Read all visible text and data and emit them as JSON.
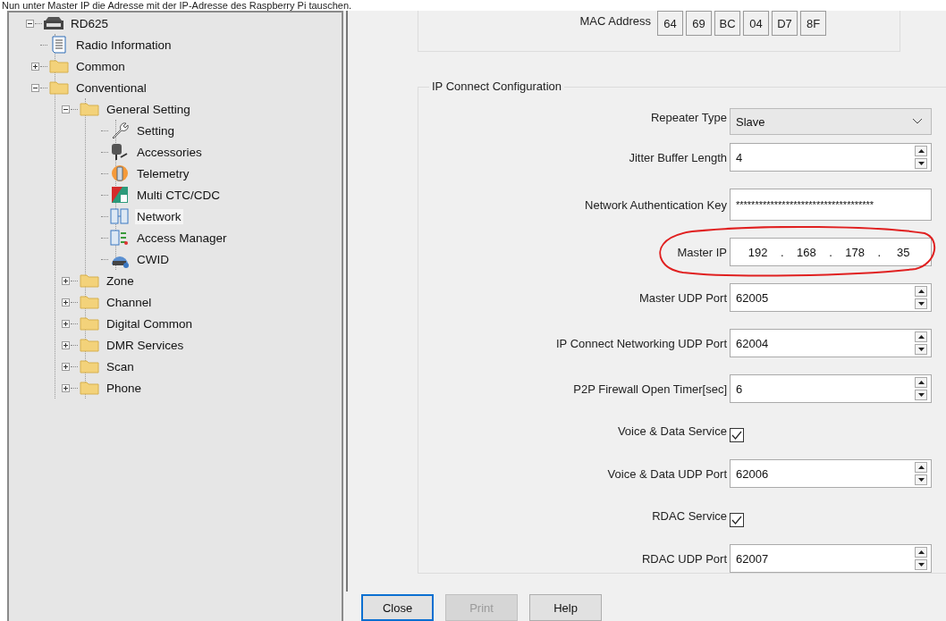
{
  "caption": "Nun unter Master IP die Adresse mit der IP-Adresse des Raspberry Pi tauschen.",
  "tree": [
    {
      "label": "RD625",
      "kind": "device",
      "expanded": true,
      "selected": false,
      "children": [
        {
          "label": "Radio Information",
          "kind": "document",
          "selected": false
        },
        {
          "label": "Common",
          "kind": "folder",
          "expanded": false,
          "selected": false
        },
        {
          "label": "Conventional",
          "kind": "folder",
          "expanded": true,
          "selected": false,
          "children": [
            {
              "label": "General Setting",
              "kind": "folder",
              "expanded": true,
              "selected": false,
              "children": [
                {
                  "label": "Setting",
                  "kind": "wrench",
                  "selected": false
                },
                {
                  "label": "Accessories",
                  "kind": "accessory",
                  "selected": false
                },
                {
                  "label": "Telemetry",
                  "kind": "telemetry",
                  "selected": false
                },
                {
                  "label": "Multi CTC/CDC",
                  "kind": "multi",
                  "selected": false
                },
                {
                  "label": "Network",
                  "kind": "network",
                  "selected": true
                },
                {
                  "label": "Access Manager",
                  "kind": "access",
                  "selected": false
                },
                {
                  "label": "CWID",
                  "kind": "cwid",
                  "selected": false
                }
              ]
            },
            {
              "label": "Zone",
              "kind": "folder",
              "expanded": false,
              "selected": false
            },
            {
              "label": "Channel",
              "kind": "folder",
              "expanded": false,
              "selected": false
            },
            {
              "label": "Digital Common",
              "kind": "folder",
              "expanded": false,
              "selected": false
            },
            {
              "label": "DMR Services",
              "kind": "folder",
              "expanded": false,
              "selected": false
            },
            {
              "label": "Scan",
              "kind": "folder",
              "expanded": false,
              "selected": false
            },
            {
              "label": "Phone",
              "kind": "folder",
              "expanded": false,
              "selected": false
            }
          ]
        }
      ]
    }
  ],
  "mac_address": {
    "label": "MAC Address",
    "octets": [
      "64",
      "69",
      "BC",
      "04",
      "D7",
      "8F"
    ]
  },
  "ip_connect": {
    "title": "IP Connect Configuration",
    "fields": [
      {
        "kind": "dropdown",
        "label": "Repeater Type",
        "value": "Slave"
      },
      {
        "kind": "spin",
        "label": "Jitter Buffer Length",
        "value": "4"
      },
      {
        "kind": "text",
        "label": "Network Authentication Key",
        "value": "************************************"
      },
      {
        "kind": "ip",
        "label": "Master IP",
        "octets": [
          "192",
          "168",
          "178",
          "35"
        ],
        "separators": [
          ".",
          ".",
          "."
        ],
        "circled": true
      },
      {
        "kind": "spin",
        "label": "Master UDP Port",
        "value": "62005"
      },
      {
        "kind": "spin",
        "label": "IP Connect Networking UDP Port",
        "value": "62004"
      },
      {
        "kind": "spin",
        "label": "P2P Firewall Open Timer[sec]",
        "value": "6"
      },
      {
        "kind": "checkbox",
        "label": "Voice & Data Service",
        "checked": true
      },
      {
        "kind": "spin",
        "label": "Voice & Data UDP Port",
        "value": "62006"
      },
      {
        "kind": "checkbox",
        "label": "RDAC Service",
        "checked": true
      },
      {
        "kind": "spin",
        "label": "RDAC UDP Port",
        "value": "62007"
      }
    ]
  },
  "buttons": [
    {
      "label": "Close",
      "disabled": false,
      "focused": true
    },
    {
      "label": "Print",
      "disabled": true,
      "focused": false
    },
    {
      "label": "Help",
      "disabled": false,
      "focused": false
    }
  ]
}
